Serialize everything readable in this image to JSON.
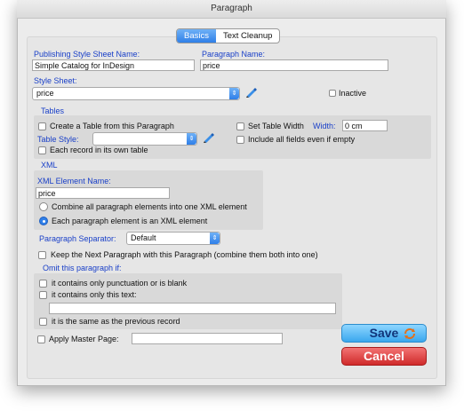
{
  "window": {
    "title": "Paragraph"
  },
  "tabs": [
    {
      "label": "Basics",
      "active": true
    },
    {
      "label": "Text Cleanup",
      "active": false
    }
  ],
  "publishing_style_sheet": {
    "label": "Publishing Style Sheet Name:",
    "value": "Simple Catalog for InDesign"
  },
  "paragraph_name": {
    "label": "Paragraph Name:",
    "value": "price"
  },
  "style_sheet": {
    "label": "Style Sheet:",
    "value": "price",
    "inactive_label": "Inactive",
    "inactive_checked": false
  },
  "tables": {
    "section_label": "Tables",
    "create_table_label": "Create a Table from this Paragraph",
    "create_table_checked": false,
    "set_table_width_label": "Set Table Width",
    "set_table_width_checked": false,
    "width_label": "Width:",
    "width_value": "0 cm",
    "table_style_label": "Table Style:",
    "table_style_value": "",
    "include_all_fields_label": "Include all fields even if empty",
    "include_all_fields_checked": false,
    "each_record_label": "Each record in its own table",
    "each_record_checked": false
  },
  "xml": {
    "section_label": "XML",
    "element_name_label": "XML Element Name:",
    "element_name_value": "price",
    "combine_label": "Combine all paragraph elements into one XML element",
    "each_label": "Each paragraph element is an XML element",
    "selected": "each"
  },
  "paragraph_separator": {
    "label": "Paragraph Separator:",
    "value": "Default"
  },
  "keep_next": {
    "label": "Keep the Next Paragraph with this Paragraph (combine them both into one)",
    "checked": false
  },
  "omit": {
    "section_label": "Omit this paragraph if:",
    "punctuation_label": "it contains only punctuation or is blank",
    "only_text_label": "it contains only this text:",
    "only_text_value": "",
    "same_as_previous_label": "it is the same as the previous record"
  },
  "apply_master_page": {
    "label": "Apply Master Page:",
    "value": "",
    "checked": false
  },
  "buttons": {
    "save": "Save",
    "cancel": "Cancel"
  },
  "colors": {
    "accent": "#2f7fe8",
    "label_blue": "#1a40c8",
    "save": "#3aa7ee",
    "cancel": "#cf2a2a"
  }
}
